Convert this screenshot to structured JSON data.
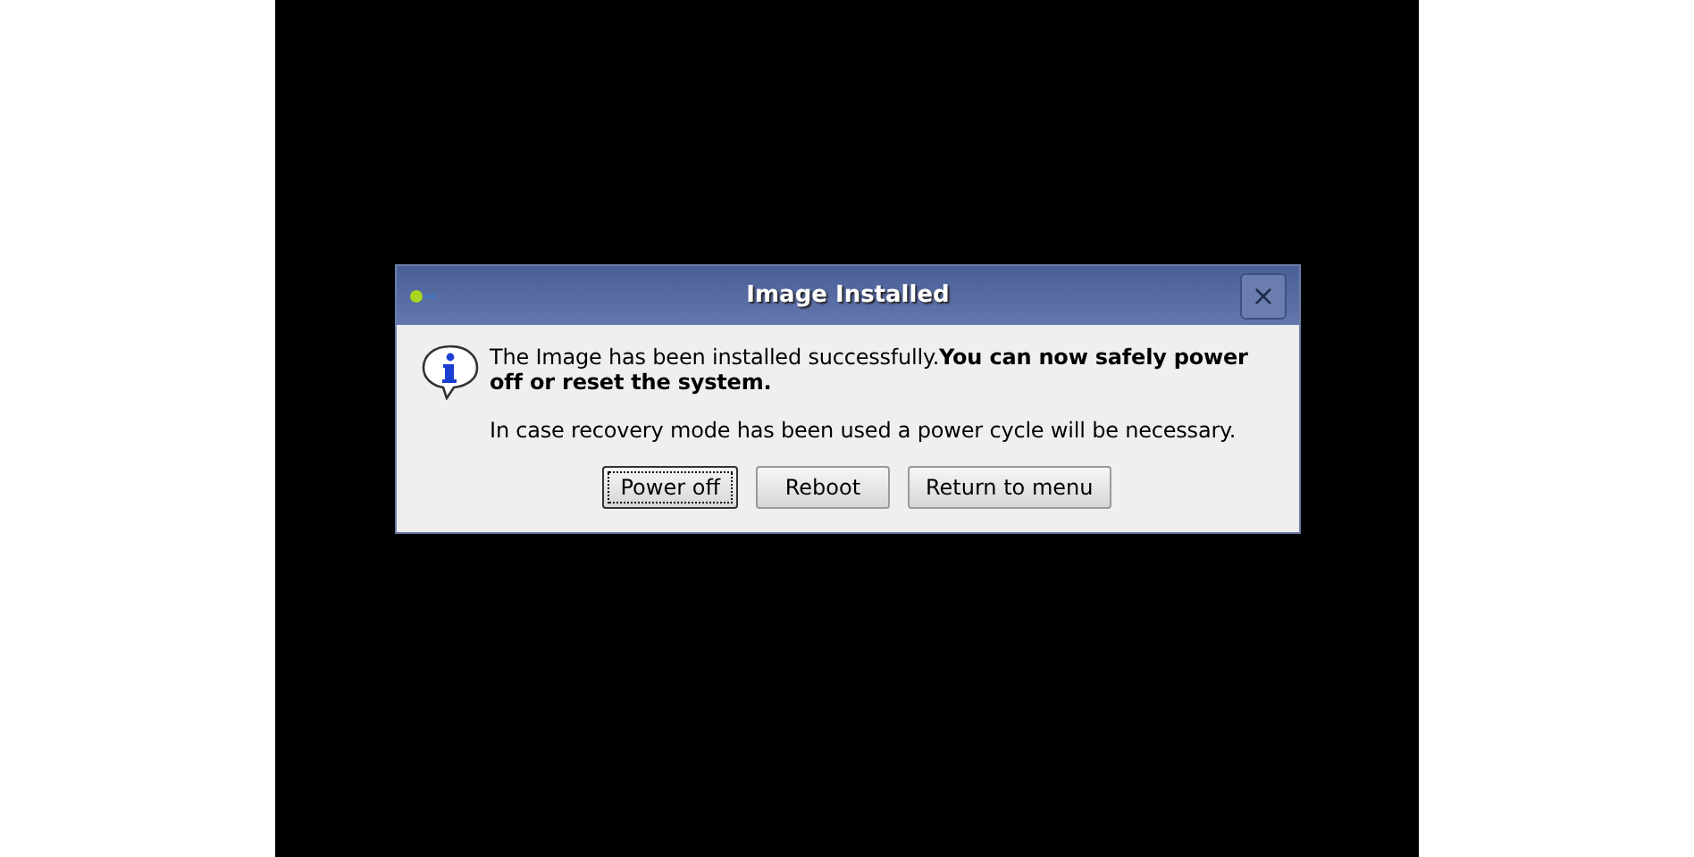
{
  "dialog": {
    "title": "Image Installed",
    "close_label": "×",
    "message": "The Image has been installed successfully.**You can now safely power off or reset the system.**",
    "note": "In case recovery mode has been used a power cycle will be necessary.",
    "buttons": [
      {
        "label": "Power off",
        "focused": true
      },
      {
        "label": "Reboot",
        "focused": false
      },
      {
        "label": "Return to menu",
        "focused": false
      }
    ]
  }
}
